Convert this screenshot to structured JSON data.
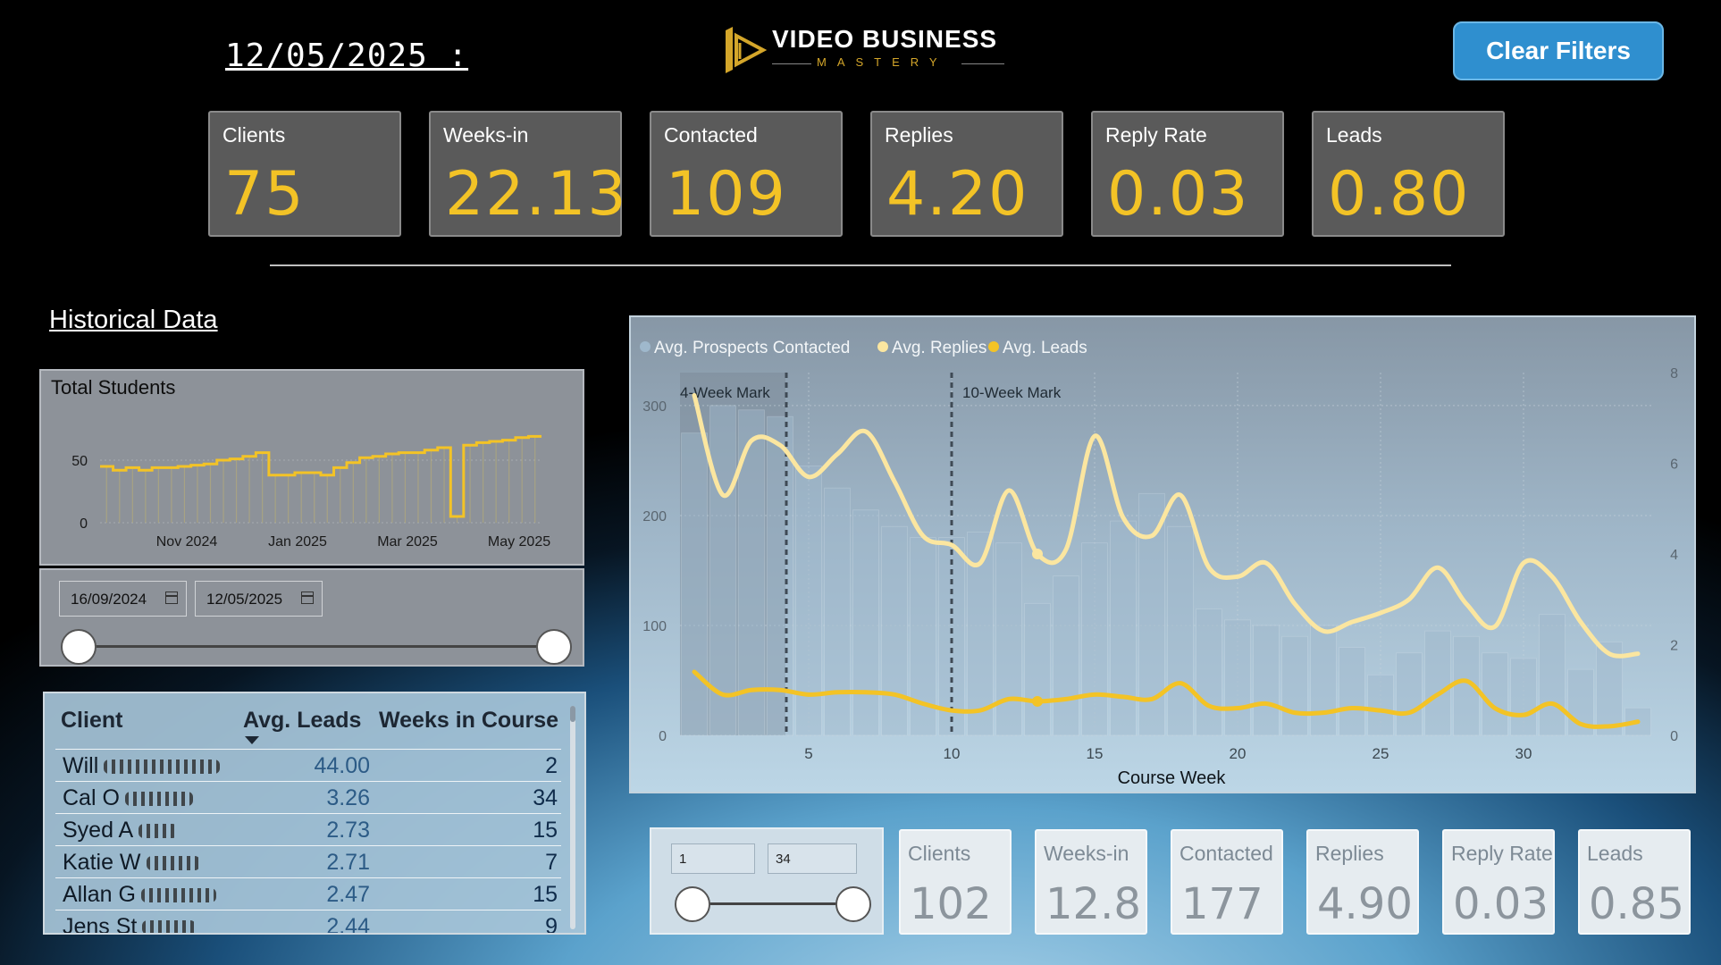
{
  "header": {
    "date": "12/05/2025 :",
    "logo_title": "VIDEO BUSINESS",
    "logo_subtitle": "MASTERY",
    "clear_filters_label": "Clear Filters"
  },
  "kpis_top": [
    {
      "label": "Clients",
      "value": "75"
    },
    {
      "label": "Weeks-in",
      "value": "22.13"
    },
    {
      "label": "Contacted",
      "value": "109"
    },
    {
      "label": "Replies",
      "value": "4.20"
    },
    {
      "label": "Reply Rate",
      "value": "0.03"
    },
    {
      "label": "Leads",
      "value": "0.80"
    }
  ],
  "historical_label": "Historical Data",
  "students_chart": {
    "title": "Total Students",
    "y_ticks": [
      "50",
      "0"
    ],
    "x_ticks": [
      "Nov 2024",
      "Jan 2025",
      "Mar 2025",
      "May 2025"
    ]
  },
  "date_slicer": {
    "start": "16/09/2024",
    "end": "12/05/2025"
  },
  "table": {
    "headers": [
      "Client",
      "Avg. Leads",
      "Weeks in Course"
    ],
    "rows": [
      {
        "client": "Will",
        "leads": "44.00",
        "weeks": "2"
      },
      {
        "client": "Cal O",
        "leads": "3.26",
        "weeks": "34"
      },
      {
        "client": "Syed A",
        "leads": "2.73",
        "weeks": "15"
      },
      {
        "client": "Katie W",
        "leads": "2.71",
        "weeks": "7"
      },
      {
        "client": "Allan G",
        "leads": "2.47",
        "weeks": "15"
      },
      {
        "client": "Jens St",
        "leads": "2.44",
        "weeks": "9"
      }
    ]
  },
  "chart_data": {
    "type": "line",
    "xlabel": "Course Week",
    "legend": [
      "Avg. Prospects Contacted",
      "Avg. Replies",
      "Avg. Leads"
    ],
    "legend_placement": "top-left",
    "colors": {
      "contacted": "#9fb8cc",
      "replies": "#fbe6a0",
      "leads": "#f3c326"
    },
    "annotations": [
      "4-Week Mark",
      "10-Week Mark"
    ],
    "markers_x": [
      4,
      10
    ],
    "x_ticks": [
      5,
      10,
      15,
      20,
      25,
      30
    ],
    "y_left_ticks": [
      0,
      100,
      200,
      300
    ],
    "y_right_ticks": [
      0,
      2,
      4,
      6,
      8
    ],
    "ylim_left": [
      0,
      330
    ],
    "ylim_right": [
      0,
      8
    ],
    "xlim": [
      0.5,
      34.5
    ],
    "x": [
      1,
      2,
      3,
      4,
      5,
      6,
      7,
      8,
      9,
      10,
      11,
      12,
      13,
      14,
      15,
      16,
      17,
      18,
      19,
      20,
      21,
      22,
      23,
      24,
      25,
      26,
      27,
      28,
      29,
      30,
      31,
      32,
      33,
      34
    ],
    "series": [
      {
        "name": "Avg. Prospects Contacted",
        "axis": "left",
        "values": [
          275,
          300,
          296,
          290,
          245,
          225,
          205,
          190,
          180,
          180,
          185,
          175,
          120,
          145,
          175,
          195,
          220,
          190,
          115,
          105,
          100,
          90,
          100,
          80,
          55,
          75,
          95,
          90,
          75,
          70,
          110,
          60,
          85,
          25
        ]
      },
      {
        "name": "Avg. Replies",
        "axis": "right",
        "values": [
          7.5,
          5.3,
          6.5,
          6.4,
          5.7,
          6.2,
          6.7,
          5.6,
          4.4,
          4.2,
          3.8,
          5.4,
          4.0,
          4.1,
          6.6,
          4.8,
          4.4,
          5.3,
          3.7,
          3.5,
          3.8,
          2.9,
          2.3,
          2.5,
          2.7,
          3.0,
          3.7,
          2.9,
          2.4,
          3.8,
          3.5,
          2.5,
          1.8,
          1.8
        ]
      },
      {
        "name": "Avg. Leads",
        "axis": "right",
        "values": [
          1.4,
          0.9,
          1.0,
          1.0,
          0.9,
          0.95,
          0.95,
          0.9,
          0.7,
          0.55,
          0.55,
          0.8,
          0.75,
          0.8,
          0.9,
          0.85,
          0.8,
          1.15,
          0.65,
          0.6,
          0.7,
          0.5,
          0.5,
          0.6,
          0.55,
          0.5,
          0.9,
          1.2,
          0.6,
          0.45,
          0.7,
          0.25,
          0.2,
          0.3
        ]
      }
    ]
  },
  "students_data": {
    "type": "area",
    "values": [
      45,
      42,
      44,
      42,
      44,
      44,
      45,
      46,
      47,
      50,
      51,
      53,
      56,
      38,
      38,
      40,
      40,
      38,
      44,
      48,
      52,
      53,
      55,
      56,
      56,
      58,
      60,
      5,
      62,
      64,
      65,
      66,
      68,
      69
    ]
  },
  "week_slicer": {
    "start": "1",
    "end": "34"
  },
  "kpis_bottom": [
    {
      "label": "Clients",
      "value": "102"
    },
    {
      "label": "Weeks-in",
      "value": "12.8"
    },
    {
      "label": "Contacted",
      "value": "177"
    },
    {
      "label": "Replies",
      "value": "4.90"
    },
    {
      "label": "Reply Rate",
      "value": "0.03"
    },
    {
      "label": "Leads",
      "value": "0.85"
    }
  ]
}
